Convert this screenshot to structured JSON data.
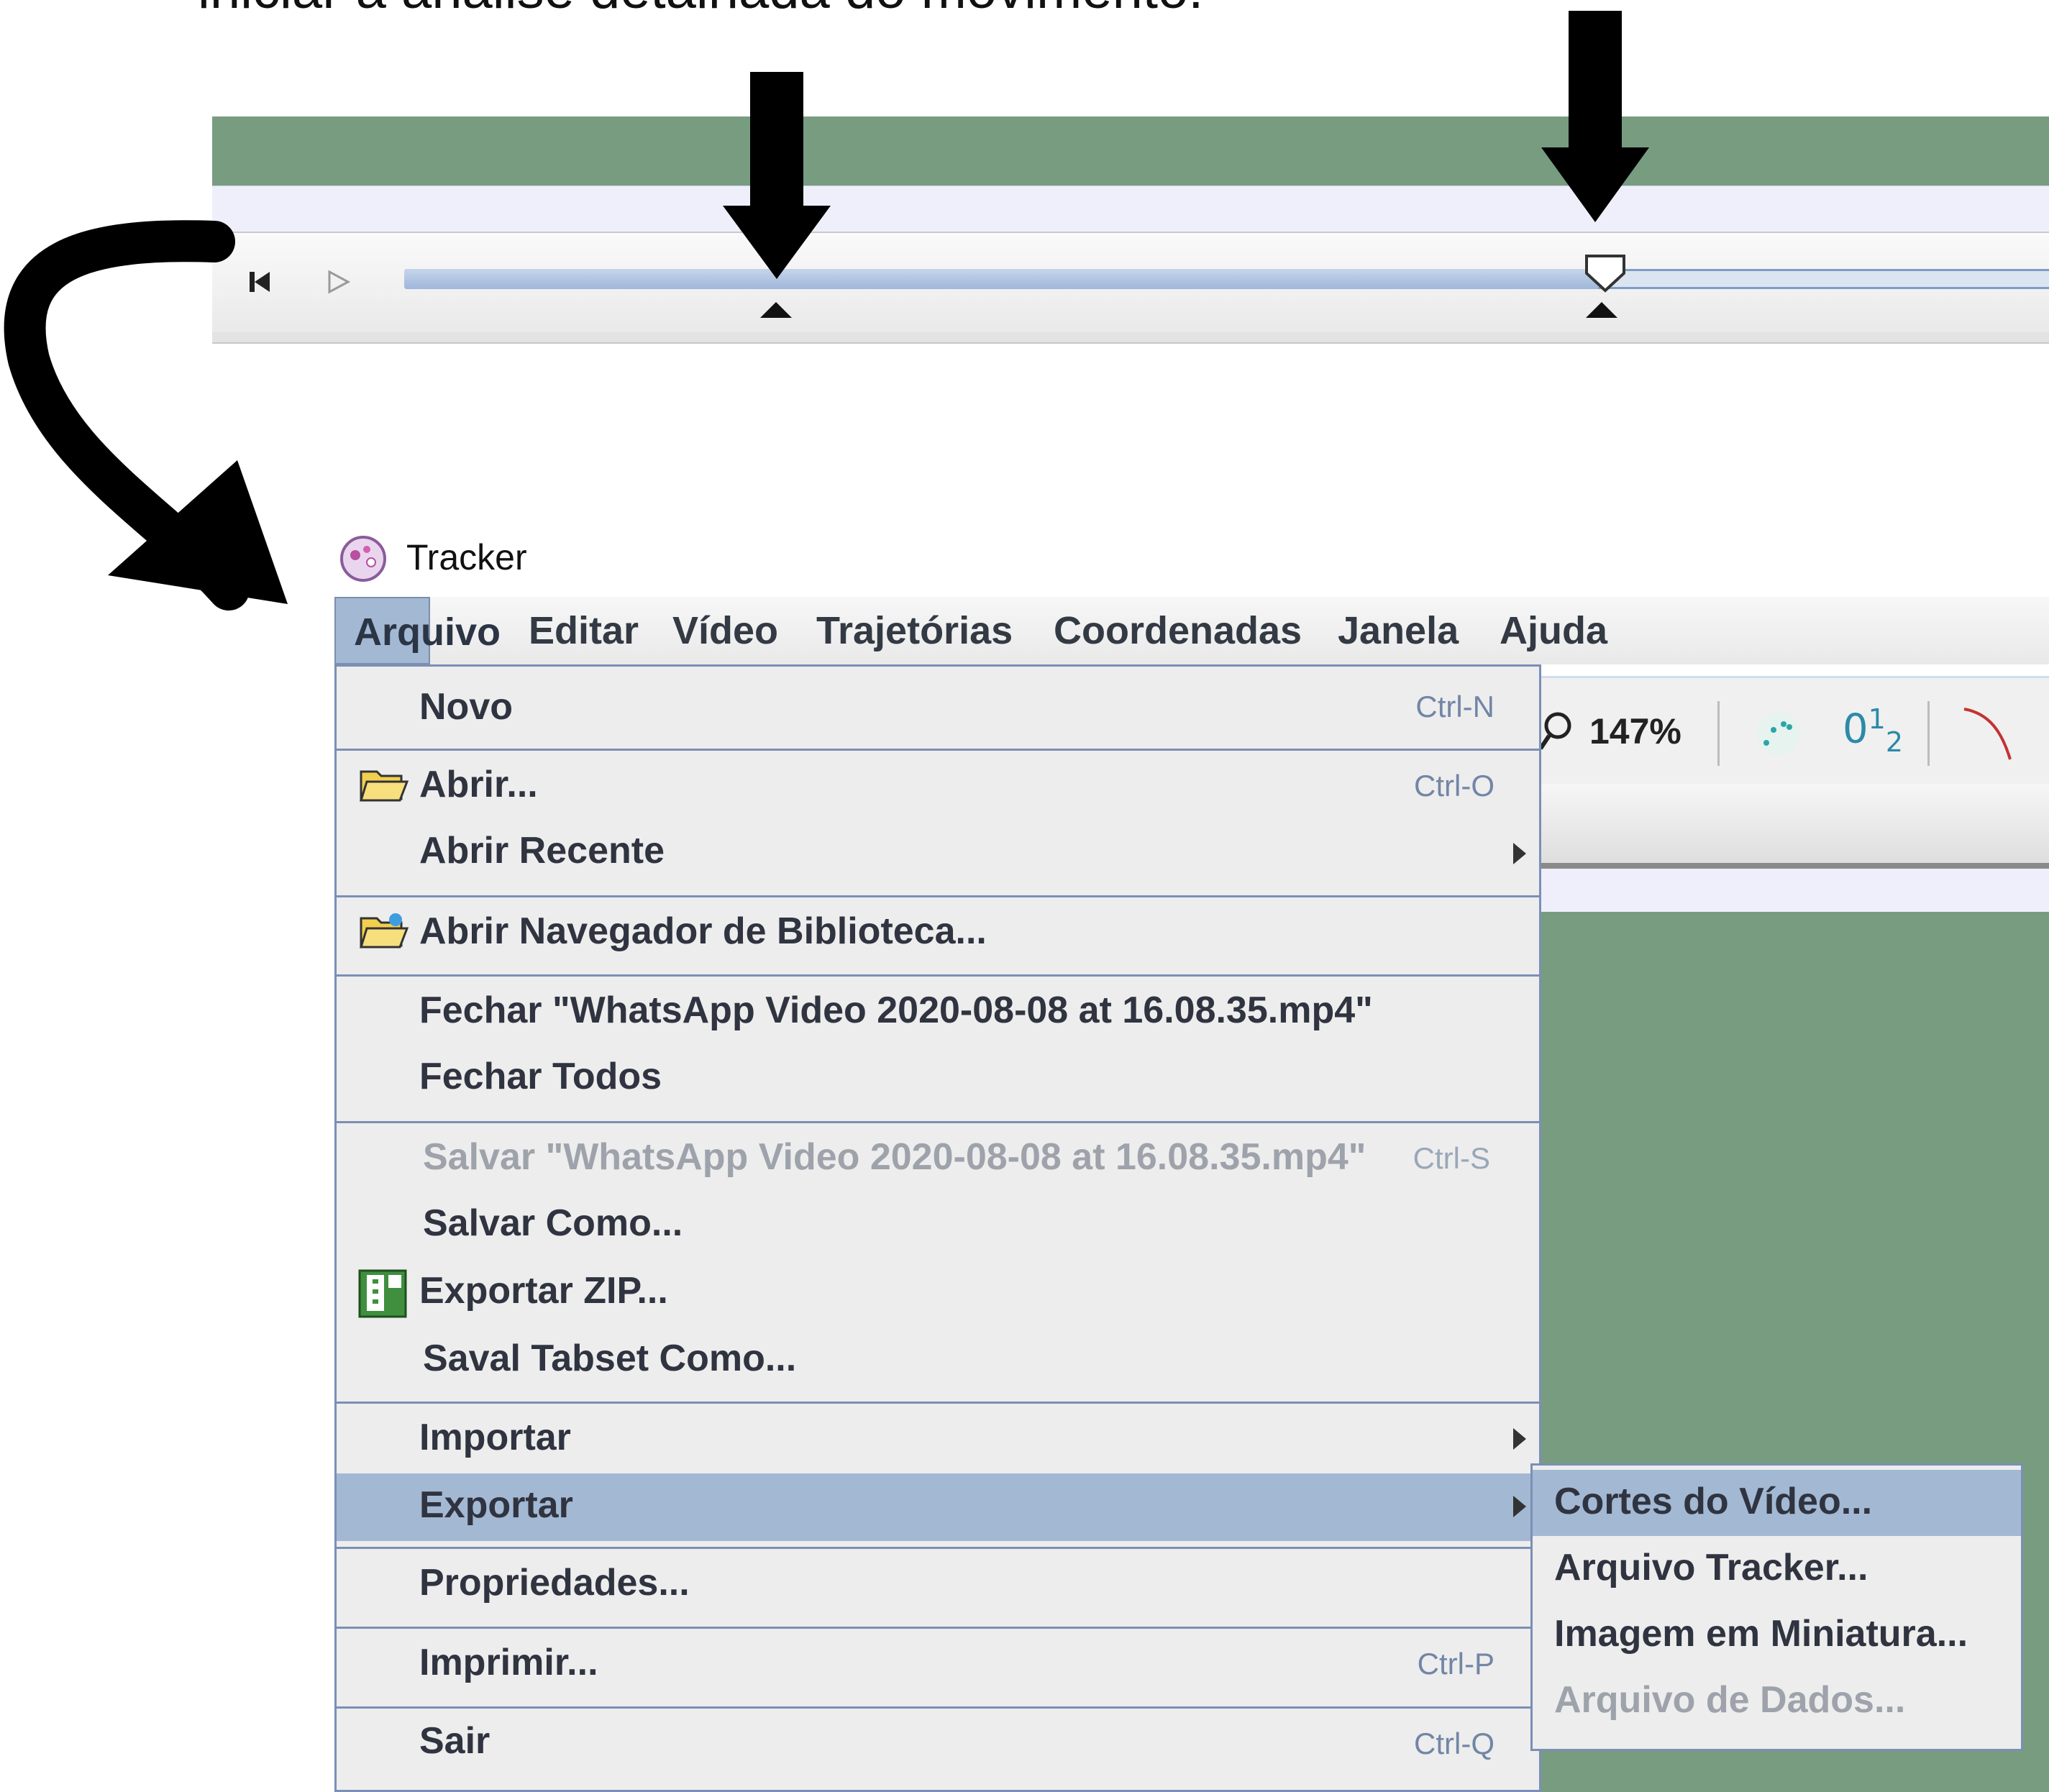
{
  "caption": "iniciar a análise detalhada do movimento.",
  "window": {
    "title": "Tracker"
  },
  "menubar": [
    "Arquivo",
    "Editar",
    "Vídeo",
    "Trajetórias",
    "Coordenadas",
    "Janela",
    "Ajuda"
  ],
  "toolbar": {
    "zoom": "147%"
  },
  "file_menu": {
    "novo": {
      "label": "Novo",
      "shortcut": "Ctrl-N"
    },
    "abrir": {
      "label": "Abrir...",
      "shortcut": "Ctrl-O"
    },
    "abrir_recente": {
      "label": "Abrir Recente"
    },
    "biblioteca": {
      "label": "Abrir Navegador de Biblioteca..."
    },
    "fechar": {
      "label": "Fechar \"WhatsApp Video 2020-08-08 at 16.08.35.mp4\""
    },
    "fechar_todos": {
      "label": "Fechar Todos"
    },
    "salvar": {
      "label": "Salvar \"WhatsApp Video 2020-08-08 at 16.08.35.mp4\"",
      "shortcut": "Ctrl-S"
    },
    "salvar_como": {
      "label": "Salvar Como..."
    },
    "exportar_zip": {
      "label": "Exportar ZIP..."
    },
    "saval_tabset": {
      "label": "Saval Tabset Como..."
    },
    "importar": {
      "label": "Importar"
    },
    "exportar": {
      "label": "Exportar"
    },
    "propriedades": {
      "label": "Propriedades..."
    },
    "imprimir": {
      "label": "Imprimir...",
      "shortcut": "Ctrl-P"
    },
    "sair": {
      "label": "Sair",
      "shortcut": "Ctrl-Q"
    }
  },
  "export_submenu": [
    "Cortes do Vídeo...",
    "Arquivo Tracker...",
    "Imagem em Miniatura...",
    "Arquivo de Dados..."
  ],
  "colors": {
    "menu_highlight": "#a3b8d3",
    "menu_border": "#7b8fb6",
    "video_bg": "#789c80"
  }
}
